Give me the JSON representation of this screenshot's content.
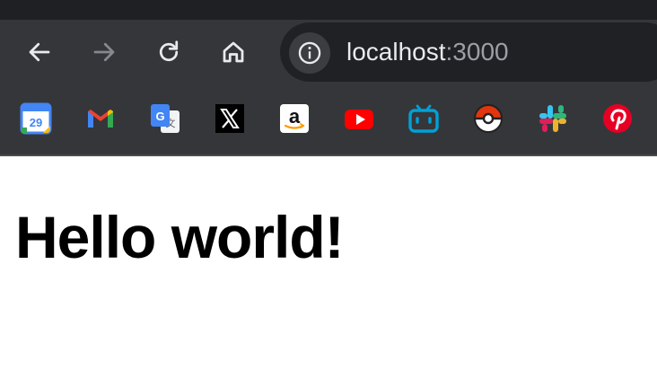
{
  "browser": {
    "address_bar": {
      "host": "localhost",
      "port": ":3000"
    },
    "nav_icons": [
      "back-arrow-icon",
      "forward-arrow-icon",
      "reload-icon",
      "home-icon"
    ],
    "bookmarks": [
      {
        "name": "google-calendar",
        "day": "29"
      },
      {
        "name": "gmail"
      },
      {
        "name": "google-translate"
      },
      {
        "name": "x"
      },
      {
        "name": "amazon"
      },
      {
        "name": "youtube"
      },
      {
        "name": "bilibili"
      },
      {
        "name": "pokeball"
      },
      {
        "name": "slack"
      },
      {
        "name": "pinterest"
      }
    ]
  },
  "page": {
    "heading": "Hello world!"
  },
  "colors": {
    "toolbar": "#35363a",
    "omnibox": "#202124",
    "url_text": "#e8eaed",
    "url_port": "#9aa0a6"
  }
}
